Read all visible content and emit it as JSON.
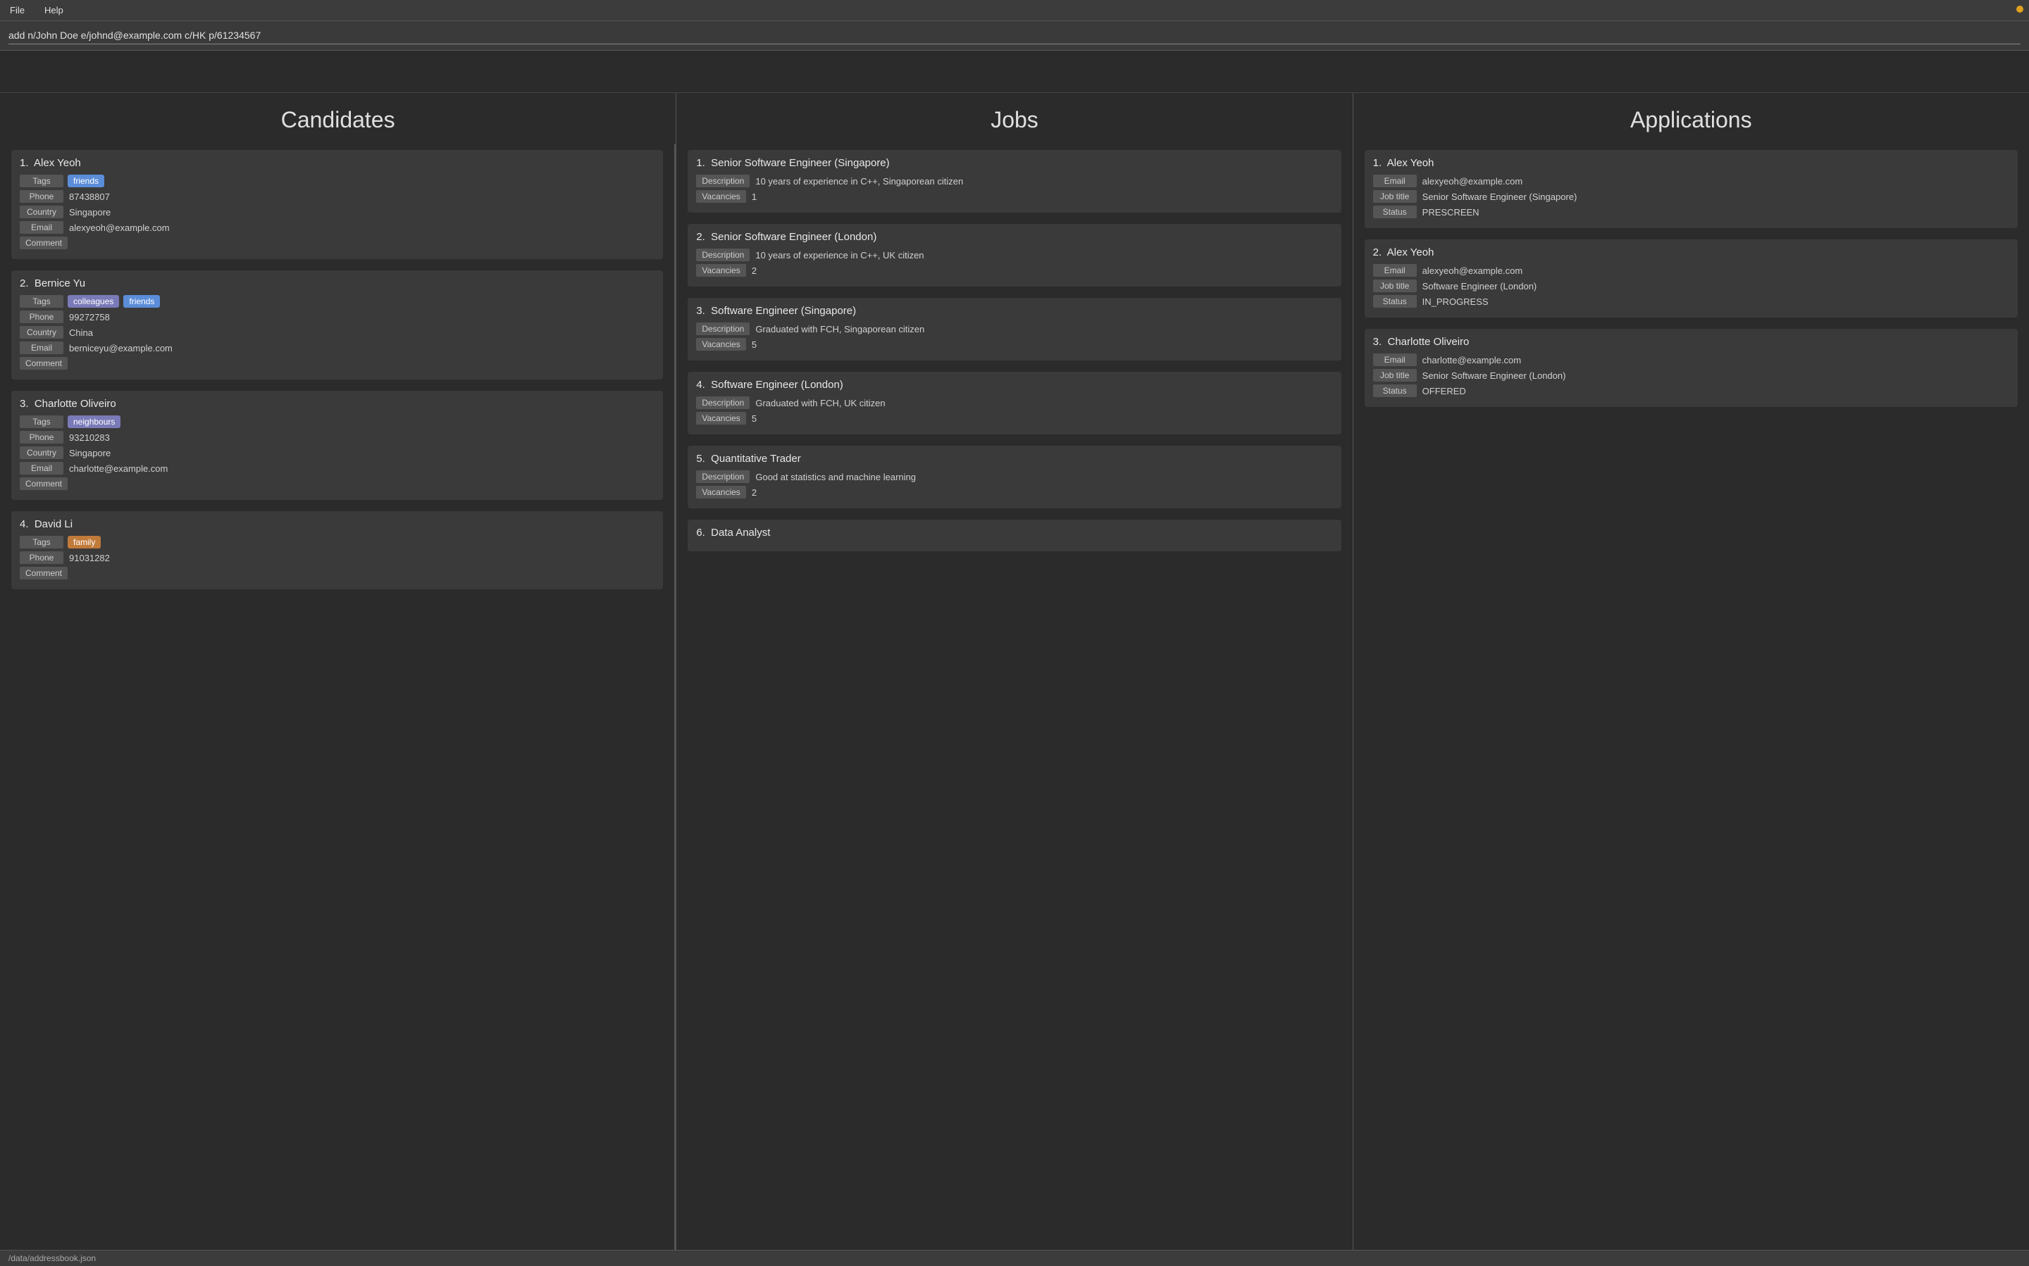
{
  "menubar": {
    "items": [
      "File",
      "Help"
    ]
  },
  "command": {
    "value": "add n/John Doe e/johnd@example.com c/HK p/61234567"
  },
  "columns": {
    "candidates": {
      "title": "Candidates",
      "items": [
        {
          "number": "1.",
          "name": "Alex Yeoh",
          "tags": [
            {
              "label": "friends",
              "type": "friends"
            }
          ],
          "phone": "87438807",
          "country": "Singapore",
          "email": "alexyeoh@example.com",
          "comment": ""
        },
        {
          "number": "2.",
          "name": "Bernice Yu",
          "tags": [
            {
              "label": "colleagues",
              "type": "colleagues"
            },
            {
              "label": "friends",
              "type": "friends"
            }
          ],
          "phone": "99272758",
          "country": "China",
          "email": "berniceyu@example.com",
          "comment": ""
        },
        {
          "number": "3.",
          "name": "Charlotte Oliveiro",
          "tags": [
            {
              "label": "neighbours",
              "type": "neighbours"
            }
          ],
          "phone": "93210283",
          "country": "Singapore",
          "email": "charlotte@example.com",
          "comment": ""
        },
        {
          "number": "4.",
          "name": "David Li",
          "tags": [
            {
              "label": "family",
              "type": "family"
            }
          ],
          "phone": "91031282",
          "country": "",
          "email": "",
          "comment": ""
        }
      ]
    },
    "jobs": {
      "title": "Jobs",
      "items": [
        {
          "number": "1.",
          "name": "Senior Software Engineer (Singapore)",
          "description": "10 years of experience in C++, Singaporean citizen",
          "vacancies": "1"
        },
        {
          "number": "2.",
          "name": "Senior Software Engineer (London)",
          "description": "10 years of experience in C++, UK citizen",
          "vacancies": "2"
        },
        {
          "number": "3.",
          "name": "Software Engineer (Singapore)",
          "description": "Graduated with FCH, Singaporean citizen",
          "vacancies": "5"
        },
        {
          "number": "4.",
          "name": "Software Engineer (London)",
          "description": "Graduated with FCH, UK citizen",
          "vacancies": "5"
        },
        {
          "number": "5.",
          "name": "Quantitative Trader",
          "description": "Good at statistics and machine learning",
          "vacancies": "2"
        },
        {
          "number": "6.",
          "name": "Data Analyst",
          "description": "",
          "vacancies": ""
        }
      ]
    },
    "applications": {
      "title": "Applications",
      "items": [
        {
          "number": "1.",
          "name": "Alex Yeoh",
          "email": "alexyeoh@example.com",
          "jobTitle": "Senior Software Engineer (Singapore)",
          "status": "PRESCREEN"
        },
        {
          "number": "2.",
          "name": "Alex Yeoh",
          "email": "alexyeoh@example.com",
          "jobTitle": "Software Engineer (London)",
          "status": "IN_PROGRESS"
        },
        {
          "number": "3.",
          "name": "Charlotte Oliveiro",
          "email": "charlotte@example.com",
          "jobTitle": "Senior Software Engineer (London)",
          "status": "OFFERED"
        }
      ]
    }
  },
  "labels": {
    "tags": "Tags",
    "phone": "Phone",
    "country": "Country",
    "email": "Email",
    "comment": "Comment",
    "description": "Description",
    "vacancies": "Vacancies",
    "job_title": "Job title",
    "status": "Status"
  },
  "statusBar": {
    "path": "/data/addressbook.json"
  }
}
